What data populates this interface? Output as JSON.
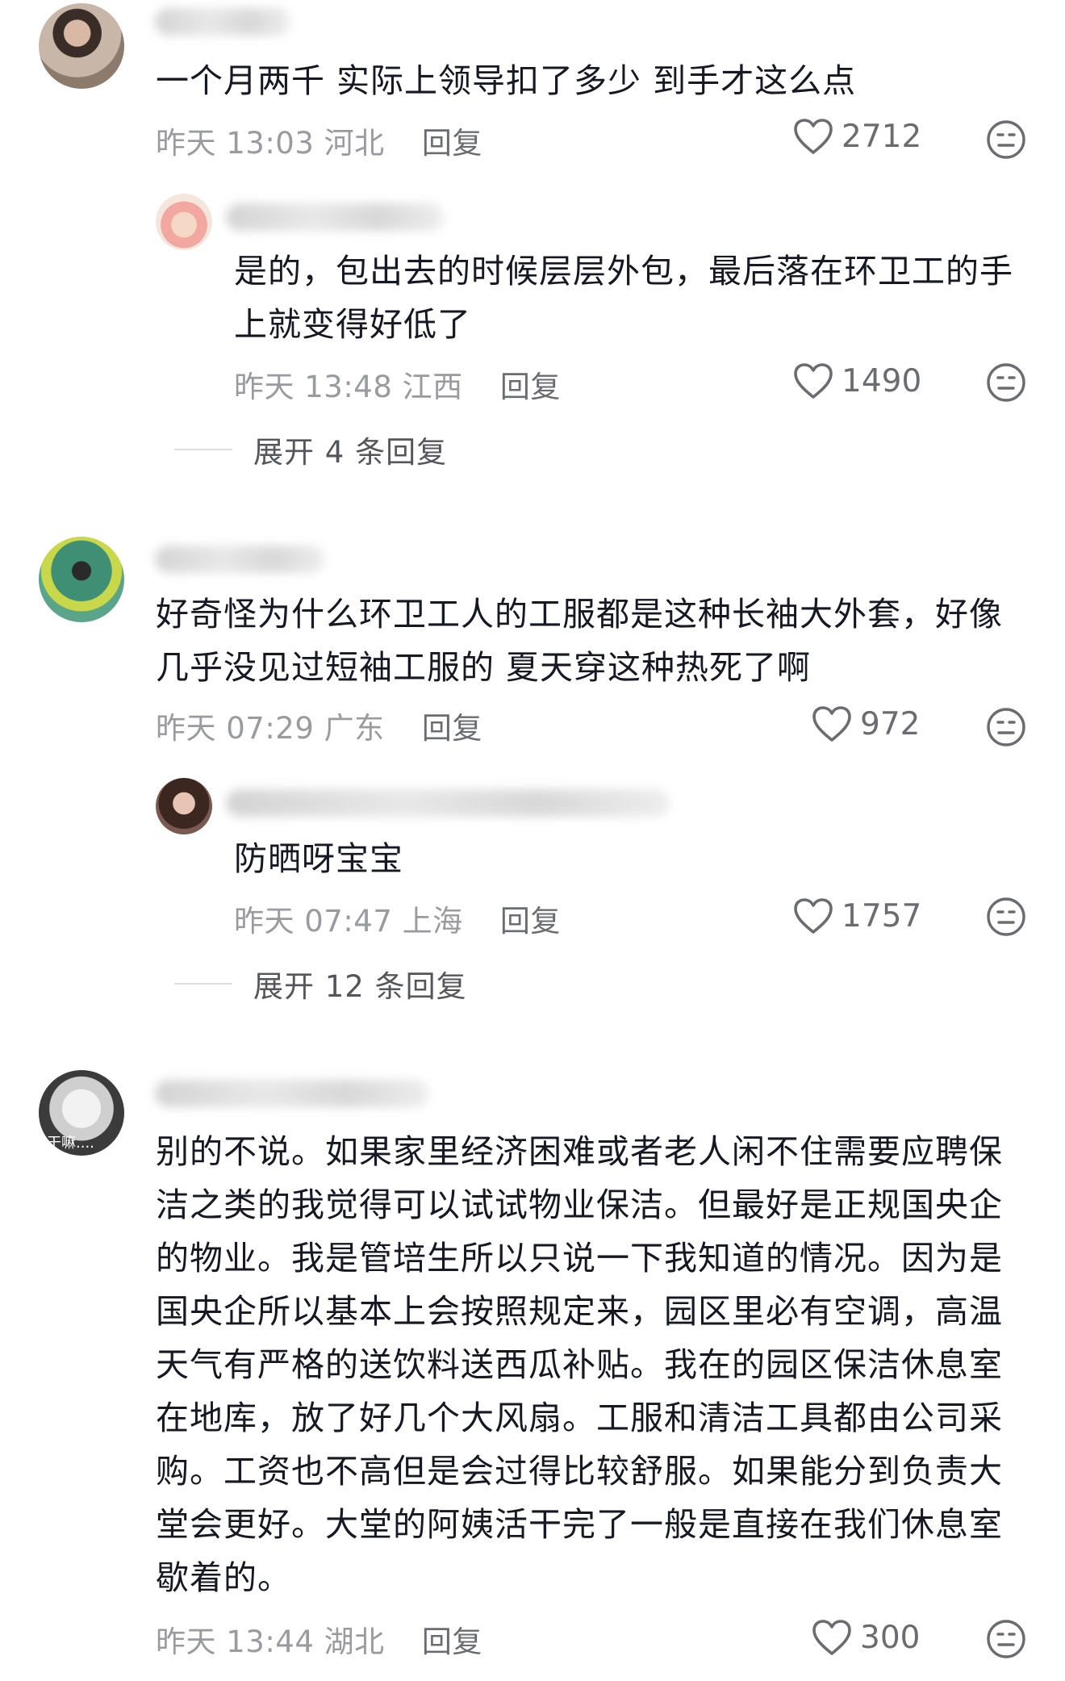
{
  "comments": [
    {
      "text": "一个月两千 实际上领导扣了多少 到手才这么点",
      "time": "昨天 13:03",
      "location": "河北",
      "reply_label": "回复",
      "likes": "2712",
      "replies": [
        {
          "text": "是的，包出去的时候层层外包，最后落在环卫工的手\n上就变得好低了",
          "time": "昨天 13:48",
          "location": "江西",
          "reply_label": "回复",
          "likes": "1490"
        }
      ],
      "expand_label": "展开 4 条回复"
    },
    {
      "text": "好奇怪为什么环卫工人的工服都是这种长袖大外套，好像\n几乎没见过短袖工服的 夏天穿这种热死了啊",
      "time": "昨天 07:29",
      "location": "广东",
      "reply_label": "回复",
      "likes": "972",
      "replies": [
        {
          "text": "防晒呀宝宝",
          "time": "昨天 07:47",
          "location": "上海",
          "reply_label": "回复",
          "likes": "1757"
        }
      ],
      "expand_label": "展开 12 条回复"
    },
    {
      "avatar_caption": "干嘛....",
      "text": "别的不说。如果家里经济困难或者老人闲不住需要应聘保\n洁之类的我觉得可以试试物业保洁。但最好是正规国央企\n的物业。我是管培生所以只说一下我知道的情况。因为是\n国央企所以基本上会按照规定来，园区里必有空调，高温\n天气有严格的送饮料送西瓜补贴。我在的园区保洁休息室\n在地库，放了好几个大风扇。工服和清洁工具都由公司采\n购。工资也不高但是会过得比较舒服。如果能分到负责大\n堂会更好。大堂的阿姨活干完了一般是直接在我们休息室\n歇着的。",
      "time": "昨天 13:44",
      "location": "湖北",
      "reply_label": "回复",
      "likes": "300"
    }
  ],
  "icons": {
    "like": "heart-outline-icon",
    "dislike": "neutral-face-icon"
  },
  "colors": {
    "text": "#161823",
    "meta": "#9a9ba0",
    "icon": "#6b6c72"
  }
}
